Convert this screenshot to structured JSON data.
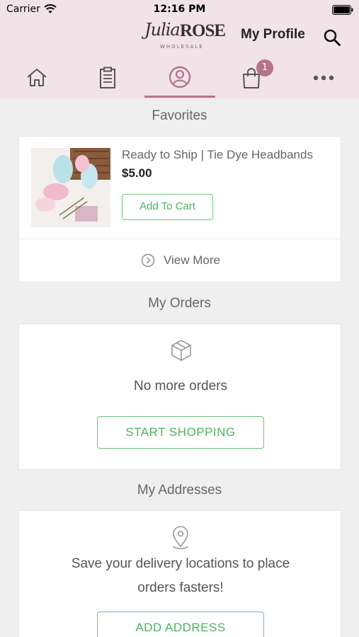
{
  "status_bar": {
    "carrier": "Carrier",
    "time": "12:16 PM"
  },
  "header": {
    "logo": {
      "script": "Julia",
      "bold": "ROSE",
      "sub": "WHOLESALE"
    },
    "title": "My Profile"
  },
  "tabs": [
    {
      "icon": "home-icon"
    },
    {
      "icon": "clipboard-icon"
    },
    {
      "icon": "user-circle-icon",
      "active": true
    },
    {
      "icon": "shopping-bag-icon",
      "badge": "1"
    },
    {
      "icon": "more-icon"
    }
  ],
  "favorites": {
    "title": "Favorites",
    "item": {
      "name": "Ready to Ship | Tie Dye Headbands",
      "price": "$5.00",
      "button": "Add To Cart"
    },
    "view_more": "View More"
  },
  "orders": {
    "title": "My Orders",
    "empty_text": "No more orders",
    "button": "START SHOPPING"
  },
  "addresses": {
    "title": "My Addresses",
    "text_line1": "Save your delivery locations to place",
    "text_line2": "orders fasters!",
    "button": "ADD ADDRESS"
  },
  "colors": {
    "accent": "#b3748a",
    "topbar": "#f2e3e8",
    "green": "#4bb35e"
  }
}
